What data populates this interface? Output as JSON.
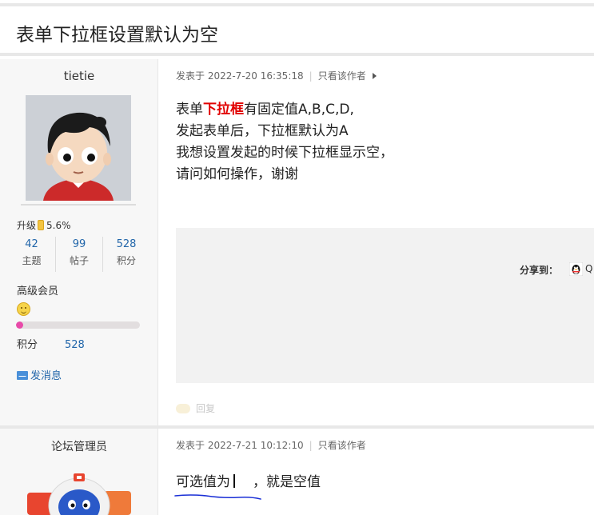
{
  "thread": {
    "title": "表单下拉框设置默认为空"
  },
  "post1": {
    "author": "tietie",
    "level_label": "升级",
    "level_progress": "5.6%",
    "stats": [
      {
        "value": "42",
        "label": "主题"
      },
      {
        "value": "99",
        "label": "帖子"
      },
      {
        "value": "528",
        "label": "积分"
      }
    ],
    "rank": "高级会员",
    "rank_progress_fraction": 0.056,
    "points_label": "积分",
    "points_value": "528",
    "message_link": "发消息",
    "meta_date": "发表于 2022-7-20 16:35:18",
    "author_only": "只看该作者",
    "content": {
      "line1_pre": "表单",
      "line1_hl": "下拉框",
      "line1_post": "有固定值A,B,C,D,",
      "line2": "发起表单后，下拉框默认为A",
      "line3": "我想设置发起的时候下拉框显示空，",
      "line4": "请问如何操作，谢谢"
    },
    "share_label": "分享到：",
    "share_qq": "Q",
    "reply": "回复"
  },
  "post2": {
    "author": "论坛管理员",
    "meta_date": "发表于 2022-7-21 10:12:10",
    "author_only": "只看该作者",
    "content_pre": "可选值为",
    "content_post": "，就是空值"
  },
  "colors": {
    "link": "#2266aa",
    "highlight": "#e10000",
    "progress": "#e84aa9",
    "annotation": "#1a2fd6"
  }
}
